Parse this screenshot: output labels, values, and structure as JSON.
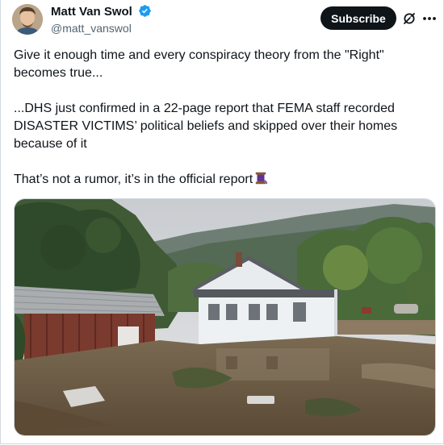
{
  "author": {
    "display_name": "Matt Van Swol",
    "handle": "@matt_vanswol",
    "verified_badge_icon": "verified-badge-icon",
    "verified_color": "#1d9bf0"
  },
  "actions": {
    "subscribe_label": "Subscribe",
    "grok_icon": "grok-icon",
    "more_icon": "more-options-icon"
  },
  "tweet": {
    "paragraph_1": "Give it enough time and every conspiracy theory from the \"Right\" becomes true...",
    "paragraph_2": "...DHS just confirmed in a 22-page report that FEMA staff recorded DISASTER VICTIMS’ political beliefs and skipped over their homes because of it",
    "paragraph_3": "That’s not a rumor, it’s in the official report",
    "paragraph_3_emoji": "thread-spool-emoji"
  },
  "media": {
    "type": "photo",
    "subject_icon": "flooded-house-photo"
  },
  "colors": {
    "text": "#0f1419",
    "secondary": "#536471",
    "button_bg": "#0f1419",
    "button_text": "#ffffff",
    "border": "#cfd9de"
  }
}
